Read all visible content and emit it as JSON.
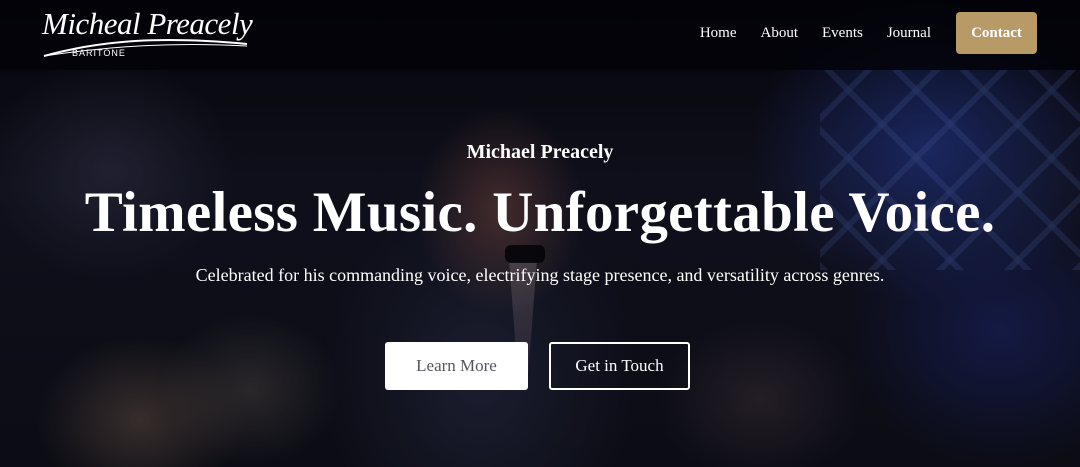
{
  "header": {
    "logo": {
      "title": "Micheal Preacely",
      "subtitle": "BARITONE"
    },
    "nav": [
      {
        "label": "Home"
      },
      {
        "label": "About"
      },
      {
        "label": "Events"
      },
      {
        "label": "Journal"
      }
    ],
    "contact_label": "Contact"
  },
  "hero": {
    "name": "Michael Preacely",
    "headline": "Timeless Music. Unforgettable Voice.",
    "tagline": "Celebrated for his commanding voice, electrifying stage presence, and versatility across genres.",
    "buttons": {
      "learn_more": "Learn More",
      "get_in_touch": "Get in Touch"
    }
  },
  "colors": {
    "accent": "#b79a66",
    "header_bg": "#030308",
    "text": "#ffffff",
    "button_text_dark": "#55575d"
  }
}
